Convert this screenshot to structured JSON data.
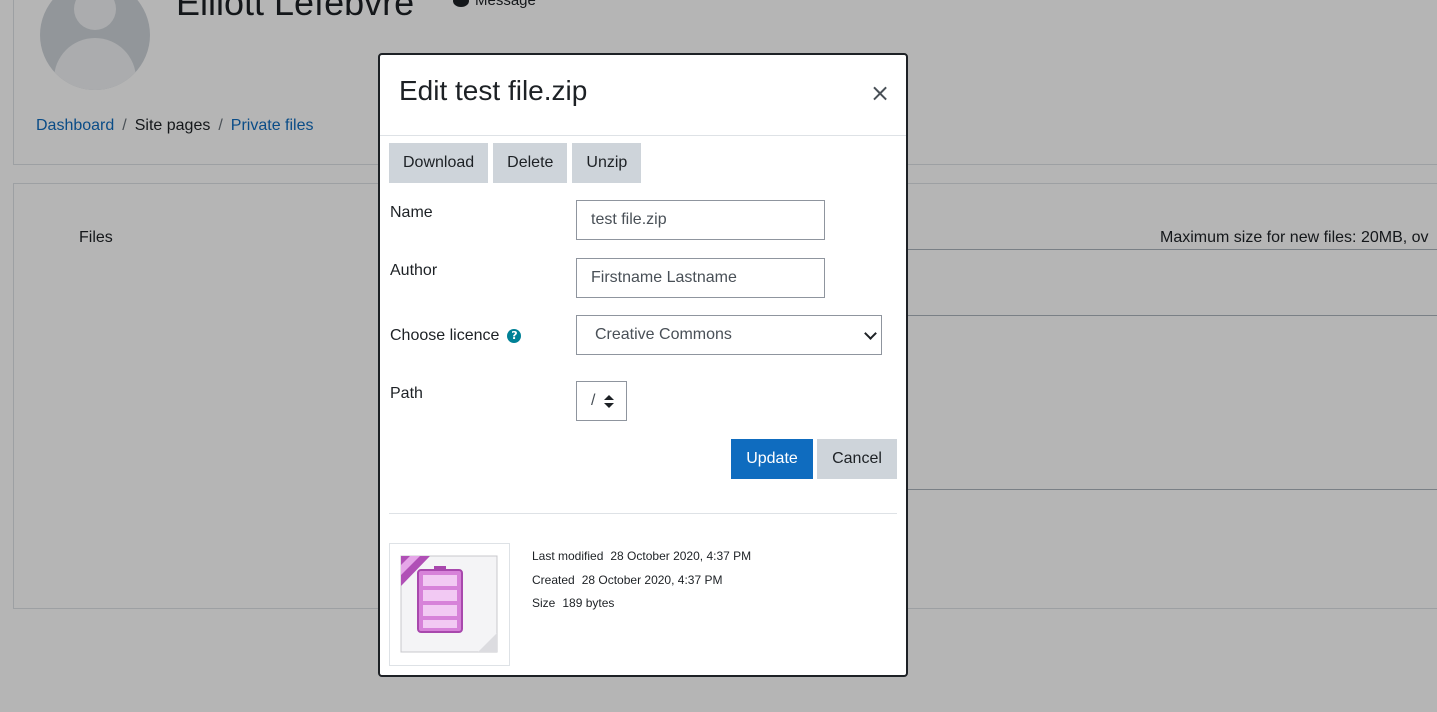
{
  "background": {
    "user_name": "Elliott Lefebvre",
    "message_label": "Message",
    "breadcrumb": {
      "dashboard": "Dashboard",
      "site_pages": "Site pages",
      "private_files": "Private files",
      "separator": "/"
    },
    "files_label": "Files",
    "max_size_text": "Maximum size for new files: 20MB, ov"
  },
  "modal": {
    "title": "Edit test file.zip",
    "close_symbol": "×",
    "toolbar": {
      "download": "Download",
      "delete": "Delete",
      "unzip": "Unzip"
    },
    "fields": {
      "name_label": "Name",
      "name_value": "test file.zip",
      "author_label": "Author",
      "author_value": "Firstname Lastname",
      "licence_label": "Choose licence",
      "licence_value": "Creative Commons",
      "help_symbol": "?",
      "path_label": "Path",
      "path_value": "/"
    },
    "update_label": "Update",
    "cancel_label": "Cancel",
    "file_info": {
      "last_modified_label": "Last modified",
      "last_modified_value": "28 October 2020, 4:37 PM",
      "created_label": "Created",
      "created_value": "28 October 2020, 4:37 PM",
      "size_label": "Size",
      "size_value": "189 bytes"
    }
  },
  "colors": {
    "primary": "#0f6cbf",
    "secondary": "#ced4da",
    "link": "#0f6cbf",
    "help_icon": "#008196",
    "archive_icon": "#c660c8"
  },
  "icons": [
    "comment-icon",
    "close-icon",
    "help-icon",
    "chevron-down-icon",
    "sort-updown-icon",
    "zip-archive-icon"
  ]
}
